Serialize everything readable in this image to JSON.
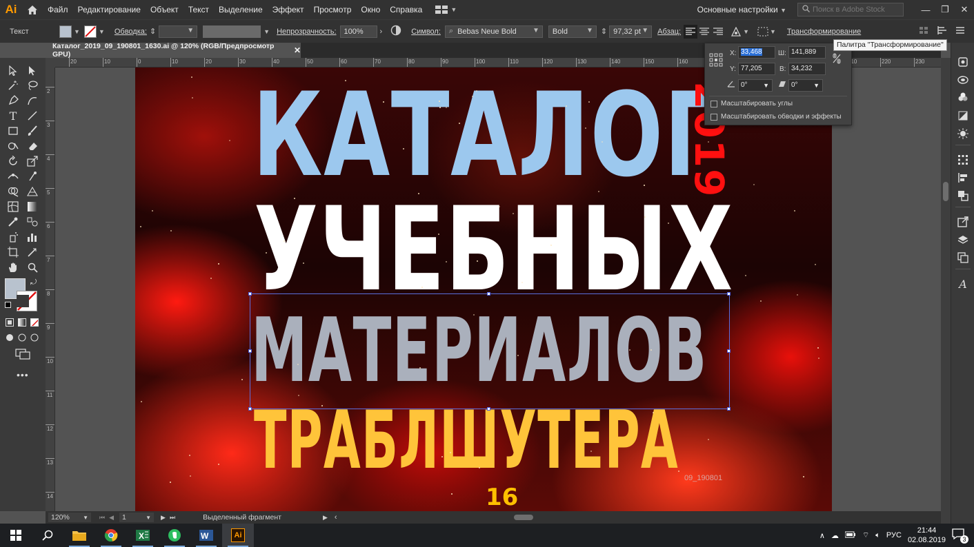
{
  "app": {
    "logo": "Ai",
    "menu": [
      "Файл",
      "Редактирование",
      "Объект",
      "Текст",
      "Выделение",
      "Эффект",
      "Просмотр",
      "Окно",
      "Справка"
    ],
    "workspace": "Основные настройки",
    "stock_search_placeholder": "Поиск в Adobe Stock",
    "window_controls": [
      "—",
      "❐",
      "✕"
    ]
  },
  "control_bar": {
    "tool_name": "Текст",
    "stroke_label": "Обводка:",
    "opacity_label": "Непрозрачность:",
    "opacity_value": "100%",
    "char_label": "Символ:",
    "font_family": "Bebas Neue Bold",
    "font_style": "Bold",
    "font_size": "97,32 pt",
    "paragraph_label": "Абзац:",
    "transform_link": "Трансформирование"
  },
  "document": {
    "tab_title": "Каталог_2019_09_190801_1630.ai @ 120% (RGB/Предпросмотр GPU)",
    "tab_close": "✕"
  },
  "ruler": {
    "h_ticks": [
      "20",
      "10",
      "0",
      "10",
      "20",
      "30",
      "40",
      "50",
      "60",
      "70",
      "80",
      "90",
      "100",
      "110",
      "120",
      "130",
      "140",
      "150",
      "160",
      "170",
      "180",
      "190",
      "200",
      "210",
      "220",
      "230"
    ],
    "v_ticks": [
      "2",
      "3",
      "4",
      "5",
      "6",
      "7",
      "8",
      "9",
      "10",
      "11",
      "12",
      "13",
      "14"
    ]
  },
  "artwork": {
    "line1": "КАТАЛОГ",
    "line2": "УЧЕБНЫХ",
    "line3": "МАТЕРИАЛОВ",
    "line4": "ТРАБЛШУТЕРА",
    "year": "2019",
    "code": "09_190801",
    "issue_number": "16",
    "colors": {
      "line1": "#9cc8ee",
      "line2": "#ffffff",
      "line3": "#aab0bc",
      "line4": "#ffc43a",
      "year": "#ff1010"
    }
  },
  "transform_panel": {
    "x_label": "X:",
    "x_value": "33,468 mm",
    "w_label": "Ш:",
    "w_value": "141,889 mm",
    "y_label": "Y:",
    "y_value": "77,205 mm",
    "h_label": "В:",
    "h_value": "34,232 mm",
    "rotate_value": "0°",
    "shear_value": "0°",
    "scale_corners": "Масштабировать углы",
    "scale_strokes": "Масштабировать обводки и эффекты",
    "tooltip": "Палитра \"Трансформирование\""
  },
  "status_bar": {
    "zoom": "120%",
    "artboard": "1",
    "status_text": "Выделенный фрагмент"
  },
  "taskbar": {
    "lang": "РУС",
    "time": "21:44",
    "date": "02.08.2019",
    "notifications": "3",
    "apps": [
      "file-explorer",
      "chrome",
      "excel",
      "evernote",
      "word",
      "illustrator"
    ]
  }
}
